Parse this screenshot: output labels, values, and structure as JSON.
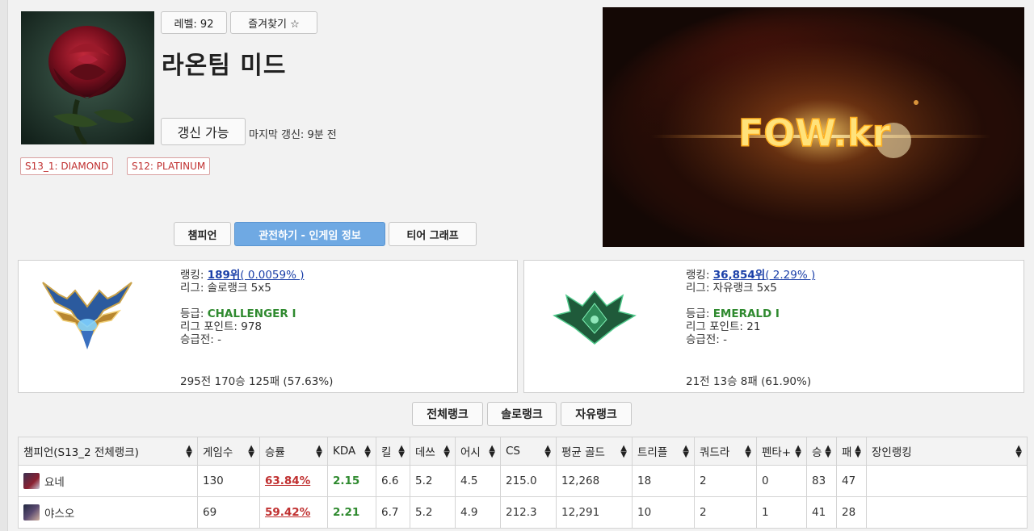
{
  "profile": {
    "level_label": "레벨: 92",
    "favorite_label": "즐겨찾기 ☆",
    "name": "라온팀 미드",
    "refresh_label": "갱신 가능",
    "last_update": "마지막 갱신: 9분 전",
    "badges": [
      "S13_1: DIAMOND",
      "S12: PLATINUM"
    ]
  },
  "video": {
    "logo_text": "FOW.kr"
  },
  "tabs": [
    "챔피언",
    "관전하기 - 인게임 정보",
    "티어 그래프"
  ],
  "solo": {
    "ranking_label": "랭킹:",
    "ranking_value": "189위",
    "ranking_pct": "( 0.0059% )",
    "league": "리그: 솔로랭크 5x5",
    "tier_label": "등급:",
    "tier_value": "CHALLENGER I",
    "lp": "리그 포인트: 978",
    "promo": "승급전: -",
    "record": "295전 170승 125패 (57.63%)"
  },
  "flex": {
    "ranking_label": "랭킹:",
    "ranking_value": "36,854위",
    "ranking_pct": "( 2.29% )",
    "league": "리그: 자유랭크 5x5",
    "tier_label": "등급:",
    "tier_value": "EMERALD I",
    "lp": "리그 포인트: 21",
    "promo": "승급전: -",
    "record": "21전 13승 8패 (61.90%)"
  },
  "queue_buttons": [
    "전체랭크",
    "솔로랭크",
    "자유랭크"
  ],
  "table": {
    "headers": [
      "챔피언(S13_2 전체랭크)",
      "게임수",
      "승률",
      "KDA",
      "킬",
      "데쓰",
      "어시",
      "CS",
      "평균 골드",
      "트리플",
      "쿼드라",
      "펜타+",
      "승",
      "패",
      "장인랭킹"
    ],
    "rows": [
      {
        "champion": "요네",
        "games": "130",
        "winrate": "63.84%",
        "kda": "2.15",
        "kills": "6.6",
        "deaths": "5.2",
        "assists": "4.5",
        "cs": "215.0",
        "gold": "12,268",
        "triple": "18",
        "quadra": "2",
        "penta": "0",
        "wins": "83",
        "losses": "47",
        "mastery": ""
      },
      {
        "champion": "야스오",
        "games": "69",
        "winrate": "59.42%",
        "kda": "2.21",
        "kills": "6.7",
        "deaths": "5.2",
        "assists": "4.9",
        "cs": "212.3",
        "gold": "12,291",
        "triple": "10",
        "quadra": "2",
        "penta": "1",
        "wins": "41",
        "losses": "28",
        "mastery": ""
      }
    ]
  },
  "colors": {
    "accent": "#6fa9e3",
    "winrate": "#c03030",
    "kda": "#2f8a2f",
    "link": "#1a3fa8"
  }
}
